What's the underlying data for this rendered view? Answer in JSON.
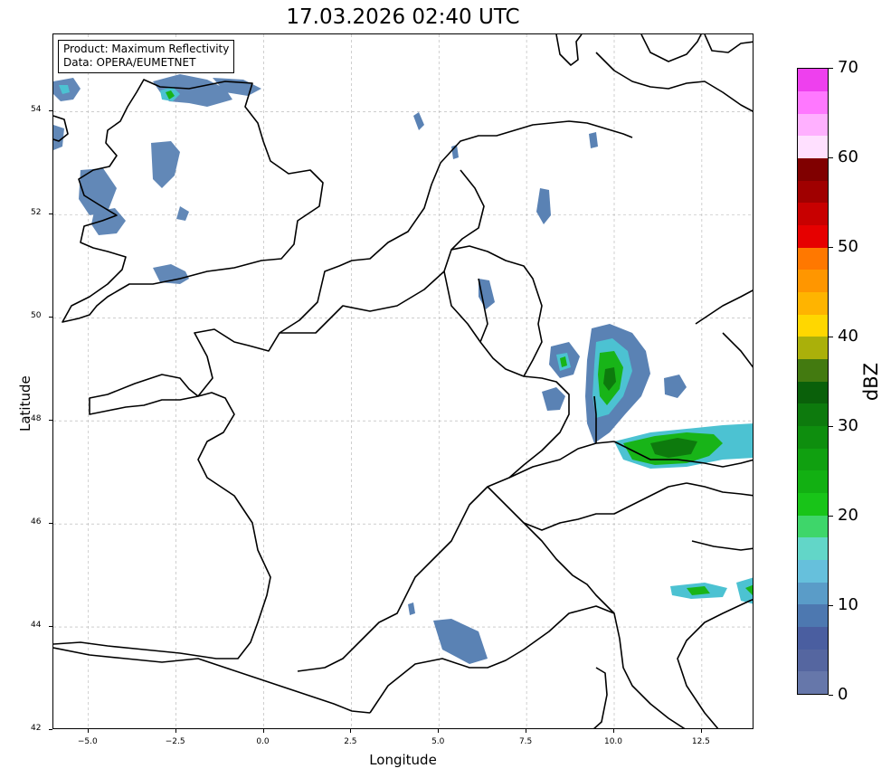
{
  "title": "17.03.2026 02:40 UTC",
  "info_box": {
    "product": "Product: Maximum Reflectivity",
    "data": "Data: OPERA/EUMETNET"
  },
  "axes": {
    "xlabel": "Longitude",
    "ylabel": "Latitude",
    "xlim": [
      -6.0,
      14.0
    ],
    "ylim": [
      42.0,
      55.5
    ],
    "x_ticks": [
      {
        "value": -5.0,
        "label": "−5.0"
      },
      {
        "value": -2.5,
        "label": "−2.5"
      },
      {
        "value": 0.0,
        "label": "0.0"
      },
      {
        "value": 2.5,
        "label": "2.5"
      },
      {
        "value": 5.0,
        "label": "5.0"
      },
      {
        "value": 7.5,
        "label": "7.5"
      },
      {
        "value": 10.0,
        "label": "10.0"
      },
      {
        "value": 12.5,
        "label": "12.5"
      }
    ],
    "y_ticks": [
      {
        "value": 42,
        "label": "42"
      },
      {
        "value": 44,
        "label": "44"
      },
      {
        "value": 46,
        "label": "46"
      },
      {
        "value": 48,
        "label": "48"
      },
      {
        "value": 50,
        "label": "50"
      },
      {
        "value": 52,
        "label": "52"
      },
      {
        "value": 54,
        "label": "54"
      }
    ],
    "grid": true
  },
  "colorbar": {
    "unit": "dBZ",
    "min": 0,
    "max": 70,
    "tick_labels": [
      "0",
      "10",
      "20",
      "30",
      "40",
      "50",
      "60",
      "70"
    ],
    "colors": [
      "#6677aa",
      "#5566a0",
      "#4a5ea0",
      "#4d78b0",
      "#5a9cc8",
      "#66c0dc",
      "#62d6c8",
      "#3ed66a",
      "#18c418",
      "#12b012",
      "#10a010",
      "#0e8e0e",
      "#0d7a0d",
      "#0a600a",
      "#437a10",
      "#aab00a",
      "#ffd700",
      "#ffb400",
      "#ff9600",
      "#ff7800",
      "#e60000",
      "#c80000",
      "#a00000",
      "#800000",
      "#ffe0ff",
      "#ffb0ff",
      "#ff78ff",
      "#ee40ee"
    ]
  },
  "colors": {
    "coastline": "#000000",
    "grid": "#b0b0b0",
    "rain_light": "#5a82b4",
    "rain_medium": "#4cc2d2",
    "rain_heavy": "#18b418"
  }
}
